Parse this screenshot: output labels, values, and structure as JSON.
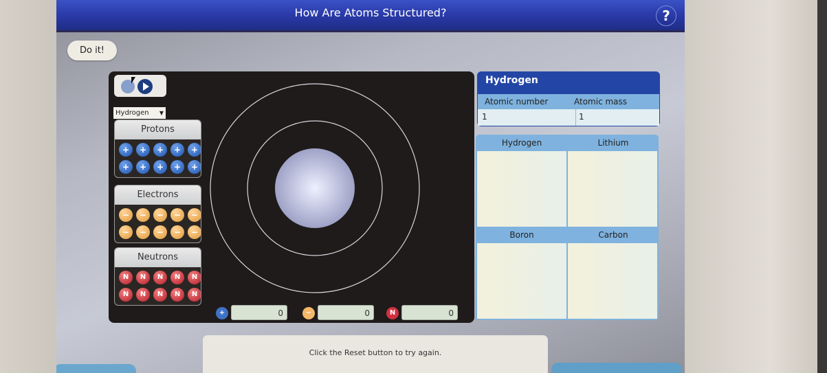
{
  "header": {
    "title": "How Are Atoms Structured?",
    "help_label": "?"
  },
  "doit_label": "Do it!",
  "simulation": {
    "element_select": {
      "selected": "Hydrogen"
    },
    "bins": [
      {
        "label": "Protons",
        "particle": "proton",
        "symbol": "+",
        "count": 10
      },
      {
        "label": "Electrons",
        "particle": "electron",
        "symbol": "−",
        "count": 10
      },
      {
        "label": "Neutrons",
        "particle": "neutron",
        "symbol": "N",
        "count": 10
      }
    ],
    "counters": {
      "protons": "0",
      "electrons": "0",
      "neutrons": "0"
    },
    "orbits": 2
  },
  "element_info": {
    "name": "Hydrogen",
    "columns": [
      "Atomic number",
      "Atomic mass"
    ],
    "values": [
      "1",
      "1"
    ]
  },
  "comparison": {
    "cells": [
      "Hydrogen",
      "Lithium",
      "Boron",
      "Carbon"
    ]
  },
  "message": "Click the Reset button to try again.",
  "colors": {
    "title_bar": "#2a3aa8",
    "proton": "#1f55b0",
    "electron": "#e09a3a",
    "neutron": "#b61f2c",
    "table_header": "#7fb2de"
  }
}
